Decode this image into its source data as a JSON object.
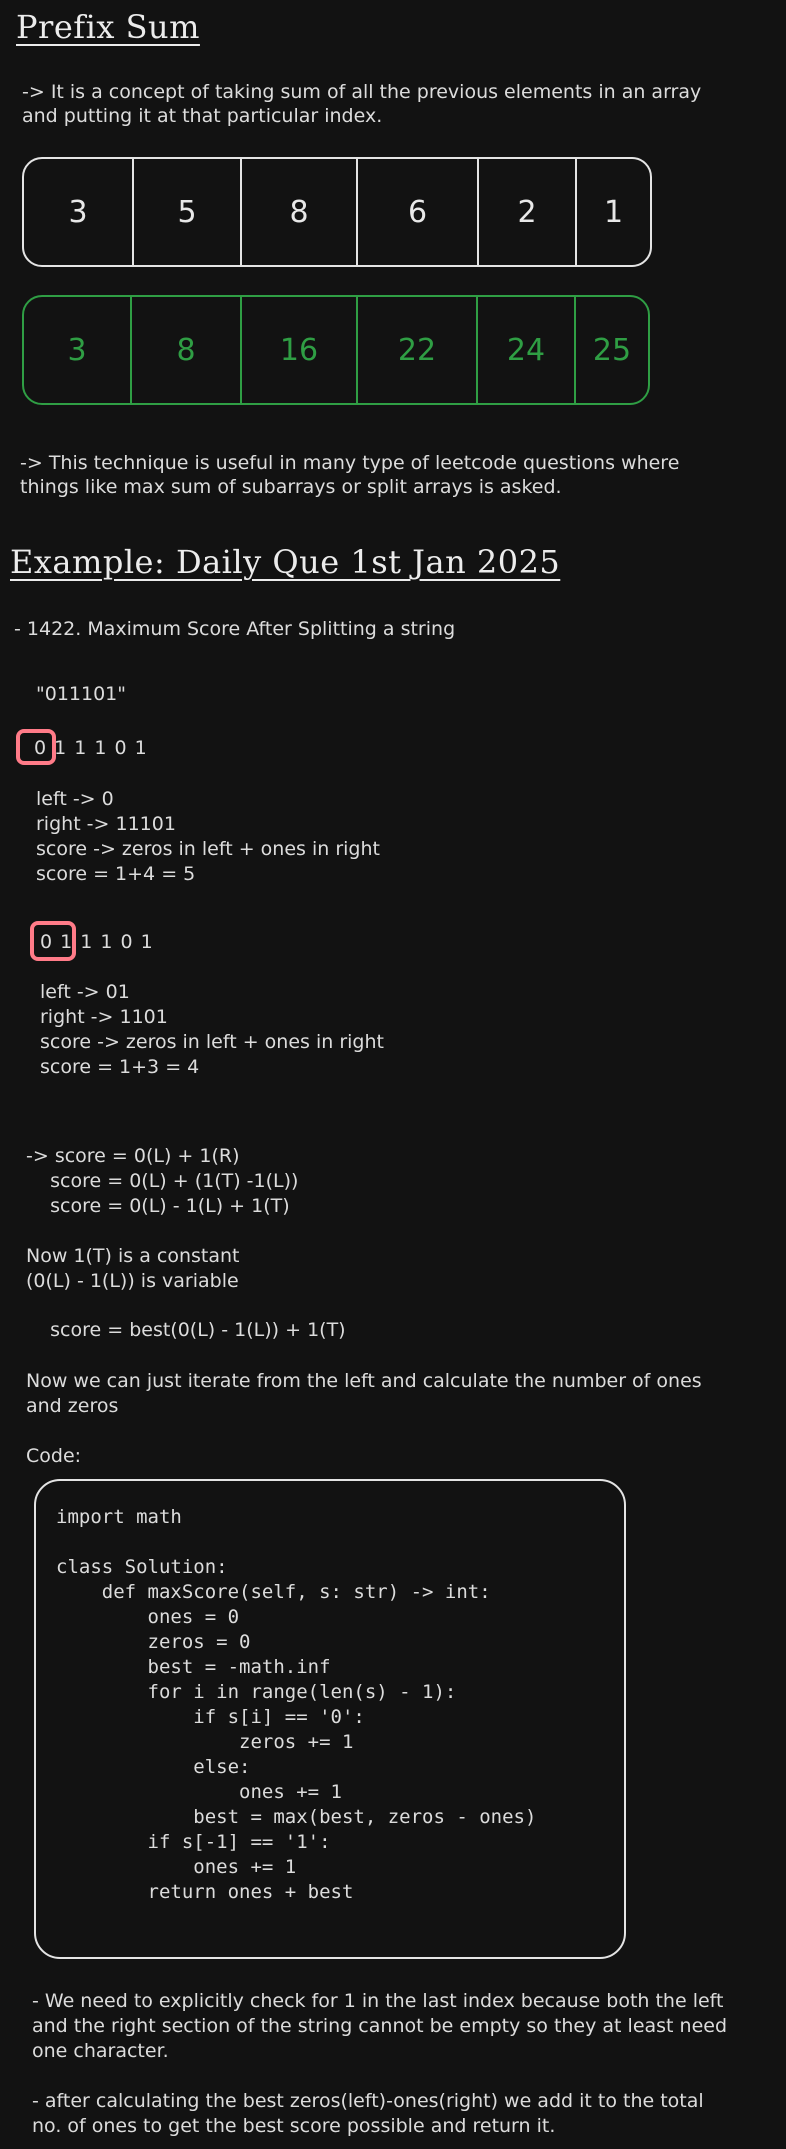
{
  "title": "Prefix Sum",
  "intro": [
    "-> It is a concept of taking sum of all the previous elements in an array",
    "and putting it at that particular index."
  ],
  "array": [
    "3",
    "5",
    "8",
    "6",
    "2",
    "1"
  ],
  "prefix_array": [
    "3",
    "8",
    "16",
    "22",
    "24",
    "25"
  ],
  "use_note": [
    "-> This technique is useful in many type of leetcode questions where",
    "things like max sum of subarrays or split arrays is asked."
  ],
  "example_title": "Example: Daily Que 1st Jan 2025",
  "problem": "- 1422. Maximum Score After Splitting a string",
  "input_string": "\"011101\"",
  "step1": {
    "digits": "0 1 1 1 0 1",
    "lines": [
      "left -> 0",
      "right -> 11101",
      "score -> zeros in left + ones in right",
      "score = 1+4 = 5"
    ]
  },
  "step2": {
    "digits": "0 1 1 1 0 1",
    "lines": [
      "left -> 01",
      "right -> 1101",
      "score -> zeros in left + ones in right",
      "score = 1+3 = 4"
    ]
  },
  "derivation": [
    "-> score = 0(L) + 1(R)",
    "    score = 0(L) + (1(T) -1(L))",
    "    score = 0(L) - 1(L) + 1(T)"
  ],
  "constant_note": [
    "Now 1(T) is a constant",
    "(0(L) - 1(L)) is variable"
  ],
  "best_formula": "    score = best(0(L) - 1(L)) + 1(T)",
  "iterate_note": [
    "Now we can just iterate from the left and calculate the number of ones",
    "and zeros"
  ],
  "code_label": "Code:",
  "code": [
    "import math",
    "",
    "class Solution:",
    "    def maxScore(self, s: str) -> int:",
    "        ones = 0",
    "        zeros = 0",
    "        best = -math.inf",
    "        for i in range(len(s) - 1):",
    "            if s[i] == '0':",
    "                zeros += 1",
    "            else:",
    "                ones += 1",
    "            best = max(best, zeros - ones)",
    "        if s[-1] == '1':",
    "            ones += 1",
    "        return ones + best"
  ],
  "note1": [
    "- We need to explicitly check for 1 in the last index because both the left",
    "and the right section of the string cannot be empty so they at least need",
    "one character."
  ],
  "note2": [
    "- after calculating the best zeros(left)-ones(right) we add it to the total",
    "no. of ones to get the best score possible and return it."
  ],
  "colors": {
    "background": "#121212",
    "text": "#e6e6e6",
    "green": "#2f9e44",
    "highlight": "#ff7b88"
  }
}
